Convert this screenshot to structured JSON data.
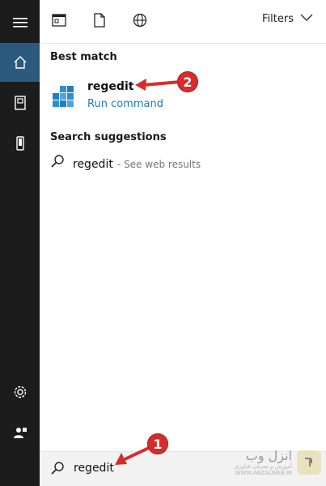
{
  "rail": {
    "items": [
      "menu-icon",
      "home-icon",
      "documents-icon",
      "device-icon",
      "settings-icon",
      "user-icon"
    ]
  },
  "toolbar": {
    "filters_label": "Filters"
  },
  "sections": {
    "best_match": "Best match",
    "suggestions": "Search suggestions"
  },
  "best_match": {
    "name": "regedit",
    "subtitle": "Run command"
  },
  "suggestion": {
    "text": "regedit",
    "subtitle": "- See web results"
  },
  "search": {
    "value": "regedit"
  },
  "annotations": {
    "badge1": "1",
    "badge2": "2"
  },
  "watermark": {
    "line1": "انزل وب",
    "line2": "آموزش و معرفی فناوری",
    "line3": "WWW.ANZALWEB.IR"
  },
  "colors": {
    "rail_bg": "#1c1c1c",
    "rail_active": "#2c5a7e",
    "accent": "#1e7ac6",
    "annotation": "#d72c2c"
  }
}
